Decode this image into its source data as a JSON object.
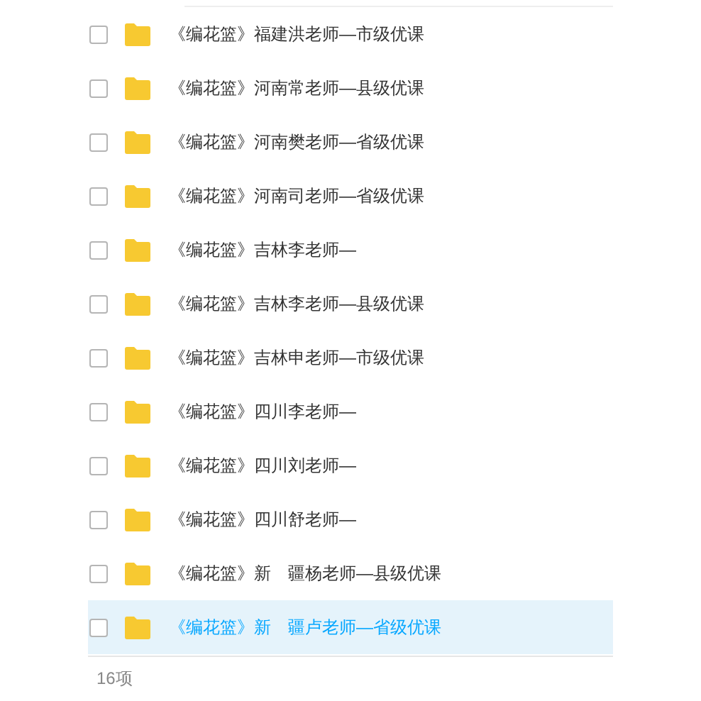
{
  "rows": [
    {
      "name": "《编花篮》福建洪老师—市级优课",
      "checked": false,
      "highlighted": false
    },
    {
      "name": "《编花篮》河南常老师—县级优课",
      "checked": false,
      "highlighted": false
    },
    {
      "name": "《编花篮》河南樊老师—省级优课",
      "checked": false,
      "highlighted": false
    },
    {
      "name": "《编花篮》河南司老师—省级优课",
      "checked": false,
      "highlighted": false
    },
    {
      "name": "《编花篮》吉林李老师—",
      "checked": false,
      "highlighted": false
    },
    {
      "name": "《编花篮》吉林李老师—县级优课",
      "checked": false,
      "highlighted": false
    },
    {
      "name": "《编花篮》吉林申老师—市级优课",
      "checked": false,
      "highlighted": false
    },
    {
      "name": "《编花篮》四川李老师—",
      "checked": false,
      "highlighted": false
    },
    {
      "name": "《编花篮》四川刘老师—",
      "checked": false,
      "highlighted": false
    },
    {
      "name": "《编花篮》四川舒老师—",
      "checked": false,
      "highlighted": false
    },
    {
      "name": "《编花篮》新　疆杨老师—县级优课",
      "checked": false,
      "highlighted": false
    },
    {
      "name": "《编花篮》新　疆卢老师—省级优课",
      "checked": false,
      "highlighted": true
    }
  ],
  "footer": {
    "count": "16项"
  }
}
